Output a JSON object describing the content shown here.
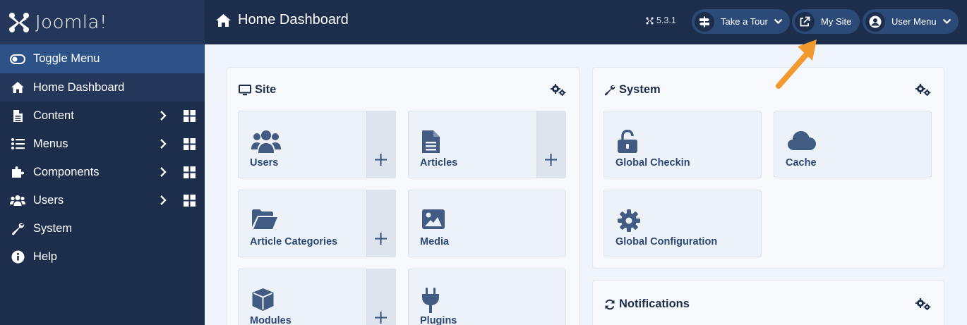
{
  "brand": {
    "name": "Joomla!"
  },
  "sidebar": {
    "toggle_label": "Toggle Menu",
    "items": [
      {
        "label": "Home Dashboard",
        "icon": "home-icon"
      },
      {
        "label": "Content",
        "icon": "file-icon"
      },
      {
        "label": "Menus",
        "icon": "list-icon"
      },
      {
        "label": "Components",
        "icon": "puzzle-icon"
      },
      {
        "label": "Users",
        "icon": "users-icon"
      },
      {
        "label": "System",
        "icon": "wrench-icon"
      },
      {
        "label": "Help",
        "icon": "info-icon"
      }
    ]
  },
  "header": {
    "title": "Home Dashboard",
    "version": "5.3.1",
    "take_tour": "Take a Tour",
    "my_site": "My Site",
    "user_menu": "User Menu"
  },
  "site_card": {
    "title": "Site",
    "tiles": [
      "Users",
      "Articles",
      "Article Categories",
      "Media",
      "Modules",
      "Plugins"
    ]
  },
  "system_card": {
    "title": "System",
    "tiles": [
      "Global Checkin",
      "Cache",
      "Global Configuration"
    ]
  },
  "notifications_card": {
    "title": "Notifications"
  },
  "colors": {
    "sidebar_bg": "#1c2e4c",
    "accent": "#2c5288",
    "tile_text": "#2a4874",
    "annotation_arrow": "#f29a2e"
  }
}
